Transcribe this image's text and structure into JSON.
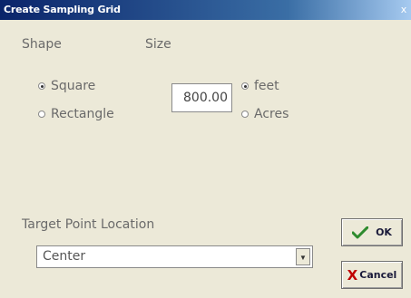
{
  "window": {
    "title": "Create Sampling Grid",
    "close_glyph": "x"
  },
  "labels": {
    "shape": "Shape",
    "size": "Size",
    "target_point_location": "Target Point Location"
  },
  "shape_options": [
    {
      "label": "Square",
      "selected": true
    },
    {
      "label": "Rectangle",
      "selected": false
    }
  ],
  "size": {
    "value": "800.00"
  },
  "unit_options": [
    {
      "label": "feet",
      "selected": true
    },
    {
      "label": "Acres",
      "selected": false
    }
  ],
  "target_location": {
    "selected": "Center",
    "arrow_glyph": "▼"
  },
  "buttons": {
    "ok_label": "OK",
    "cancel_label": "Cancel",
    "cancel_glyph": "X"
  },
  "colors": {
    "title_gradient_start": "#0a246a",
    "dialog_background": "#ece9d8",
    "ok_check": "#2e8b2e",
    "cancel_x": "#c00000"
  }
}
